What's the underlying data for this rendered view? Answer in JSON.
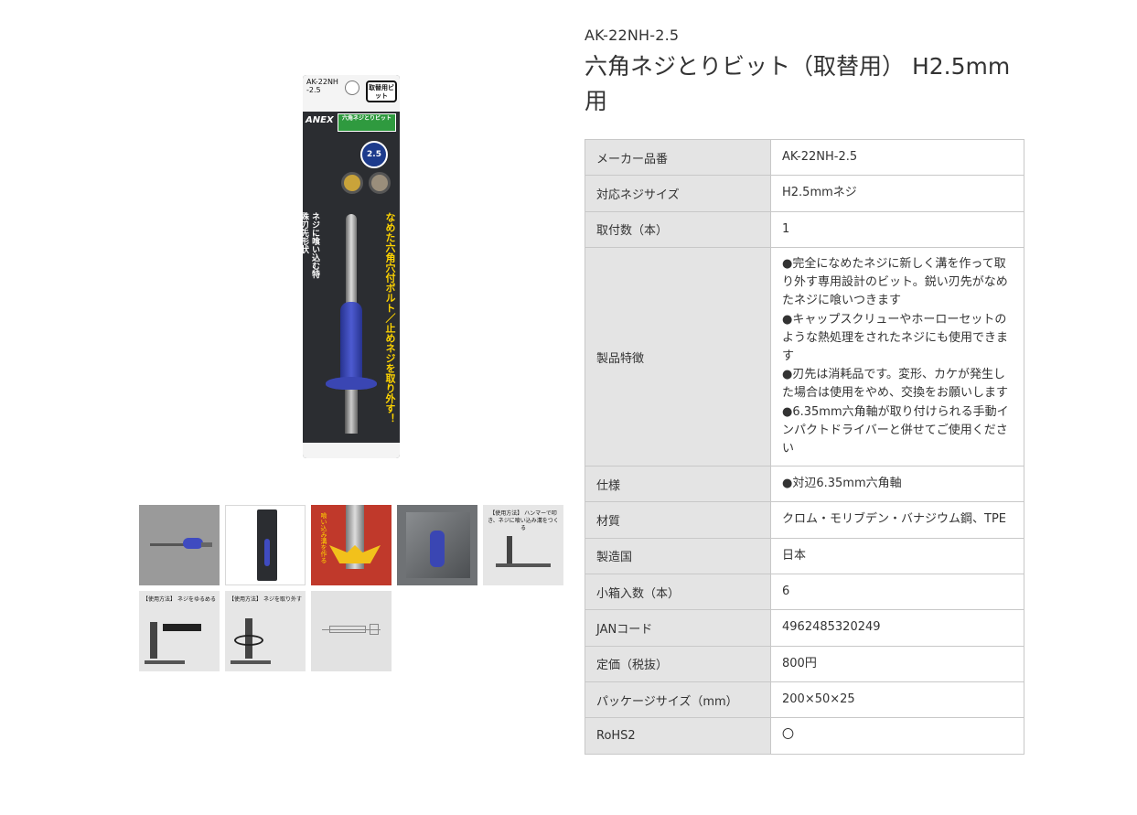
{
  "product": {
    "model_code": "AK-22NH-2.5",
    "title": "六角ネジとりビット（取替用） H2.5mm用"
  },
  "gallery": {
    "main_image_label": "product-package",
    "package": {
      "model_line1": "AK-22NH",
      "model_line2": "-2.5",
      "badge": "取替用ビット",
      "brand": "ANEX",
      "green_label": "六角ネジとりビット",
      "size": "2.5",
      "yellow_text": "なめた六角穴付ボルト／止めネジを取り外す！",
      "white_text": "ネジに喰い込む特殊刃先形状"
    },
    "thumbnails": [
      {
        "id": "thumb-1",
        "caption": ""
      },
      {
        "id": "thumb-2",
        "caption": ""
      },
      {
        "id": "thumb-3",
        "caption": "喰い込み溝を作る"
      },
      {
        "id": "thumb-4",
        "caption": ""
      },
      {
        "id": "thumb-5",
        "caption": "【使用方法】 ハンマーで叩き、ネジに喰い込み溝をつくる"
      },
      {
        "id": "thumb-6",
        "caption": "【使用方法】 ネジをゆるめる"
      },
      {
        "id": "thumb-7",
        "caption": "【使用方法】 ネジを取り外す"
      },
      {
        "id": "thumb-8",
        "caption": ""
      }
    ]
  },
  "specs": {
    "rows": [
      {
        "key": "メーカー品番",
        "value": "AK-22NH-2.5"
      },
      {
        "key": "対応ネジサイズ",
        "value": "H2.5mmネジ"
      },
      {
        "key": "取付数（本）",
        "value": "1"
      },
      {
        "key": "製品特徴",
        "value": "●完全になめたネジに新しく溝を作って取り外す専用設計のビット。鋭い刃先がなめたネジに喰いつきます\n●キャップスクリューやホーローセットのような熱処理をされたネジにも使用できます\n●刃先は消耗品です。変形、カケが発生した場合は使用をやめ、交換をお願いします\n●6.35mm六角軸が取り付けられる手動インパクトドライバーと併せてご使用ください"
      },
      {
        "key": "仕様",
        "value": "●対辺6.35mm六角軸"
      },
      {
        "key": "材質",
        "value": "クロム・モリブデン・バナジウム鋼、TPE"
      },
      {
        "key": "製造国",
        "value": "日本"
      },
      {
        "key": "小箱入数（本）",
        "value": "6"
      },
      {
        "key": "JANコード",
        "value": "4962485320249"
      },
      {
        "key": "定価（税抜）",
        "value": "800円"
      },
      {
        "key": "パッケージサイズ（mm）",
        "value": "200×50×25"
      },
      {
        "key": "RoHS2",
        "value": "〇"
      }
    ]
  }
}
